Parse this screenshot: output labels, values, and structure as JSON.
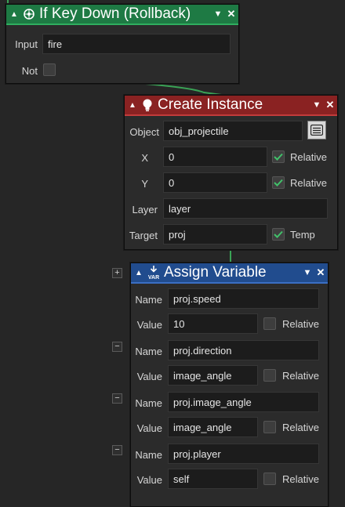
{
  "colors": {
    "key_header": "#1e7a44",
    "create_header": "#8a2222",
    "assign_header": "#214c8e",
    "wire": "#3aa356",
    "check": "#41c16a"
  },
  "if_key_down": {
    "title": "If Key Down (Rollback)",
    "icon": "gamepad-icon",
    "input_label": "Input",
    "input_value": "fire",
    "not_label": "Not",
    "not_checked": false
  },
  "create_instance": {
    "title": "Create Instance",
    "icon": "lightbulb-icon",
    "object_label": "Object",
    "object_value": "obj_projectile",
    "object_picker_icon": "menu-picker-icon",
    "x_label": "X",
    "x_value": "0",
    "x_relative_label": "Relative",
    "x_relative": true,
    "y_label": "Y",
    "y_value": "0",
    "y_relative_label": "Relative",
    "y_relative": true,
    "layer_label": "Layer",
    "layer_value": "layer",
    "target_label": "Target",
    "target_value": "proj",
    "temp_label": "Temp",
    "temp_checked": true
  },
  "assign_variable": {
    "title": "Assign Variable",
    "icon": "var-download-icon",
    "add_symbol": "+",
    "remove_symbol": "−",
    "name_label": "Name",
    "value_label": "Value",
    "relative_label": "Relative",
    "rows": [
      {
        "name": "proj.speed",
        "value": "10",
        "relative": false
      },
      {
        "name": "proj.direction",
        "value": "image_angle",
        "relative": false
      },
      {
        "name": "proj.image_angle",
        "value": "image_angle",
        "relative": false
      },
      {
        "name": "proj.player",
        "value": "self",
        "relative": false
      }
    ]
  },
  "header_controls": {
    "collapse": "▲",
    "dropdown": "▼",
    "close": "✕"
  }
}
